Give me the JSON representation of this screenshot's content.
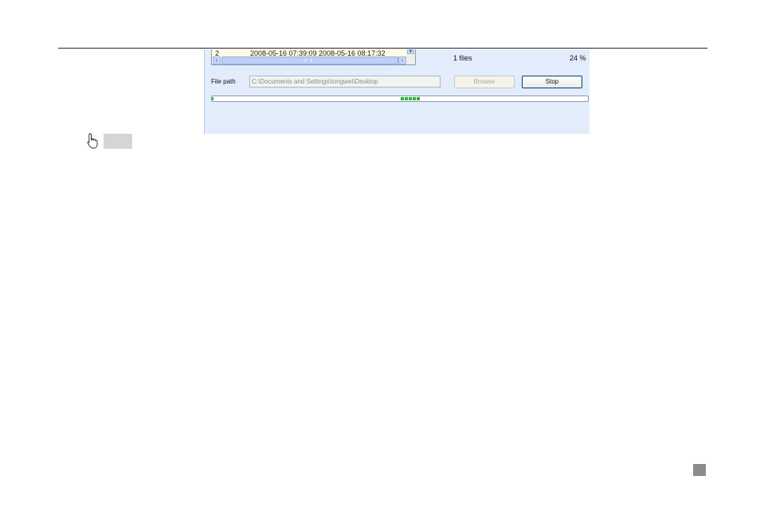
{
  "file_list": {
    "row": {
      "index": "2",
      "start_time": "2008-05-16 07:39:09",
      "end_time": "2008-05-16 08:17:32"
    }
  },
  "summary": {
    "file_count": "1 files",
    "percent": "24 %"
  },
  "file_path": {
    "label": "File path",
    "value": "C:\\Documents and Settings\\tongwei\\Desktop"
  },
  "buttons": {
    "browse": "Browse",
    "stop": "Stop"
  },
  "progress": {
    "value": 0.24
  },
  "colors": {
    "panel": "#e3ecfb",
    "progress_fill": "#28b628"
  }
}
